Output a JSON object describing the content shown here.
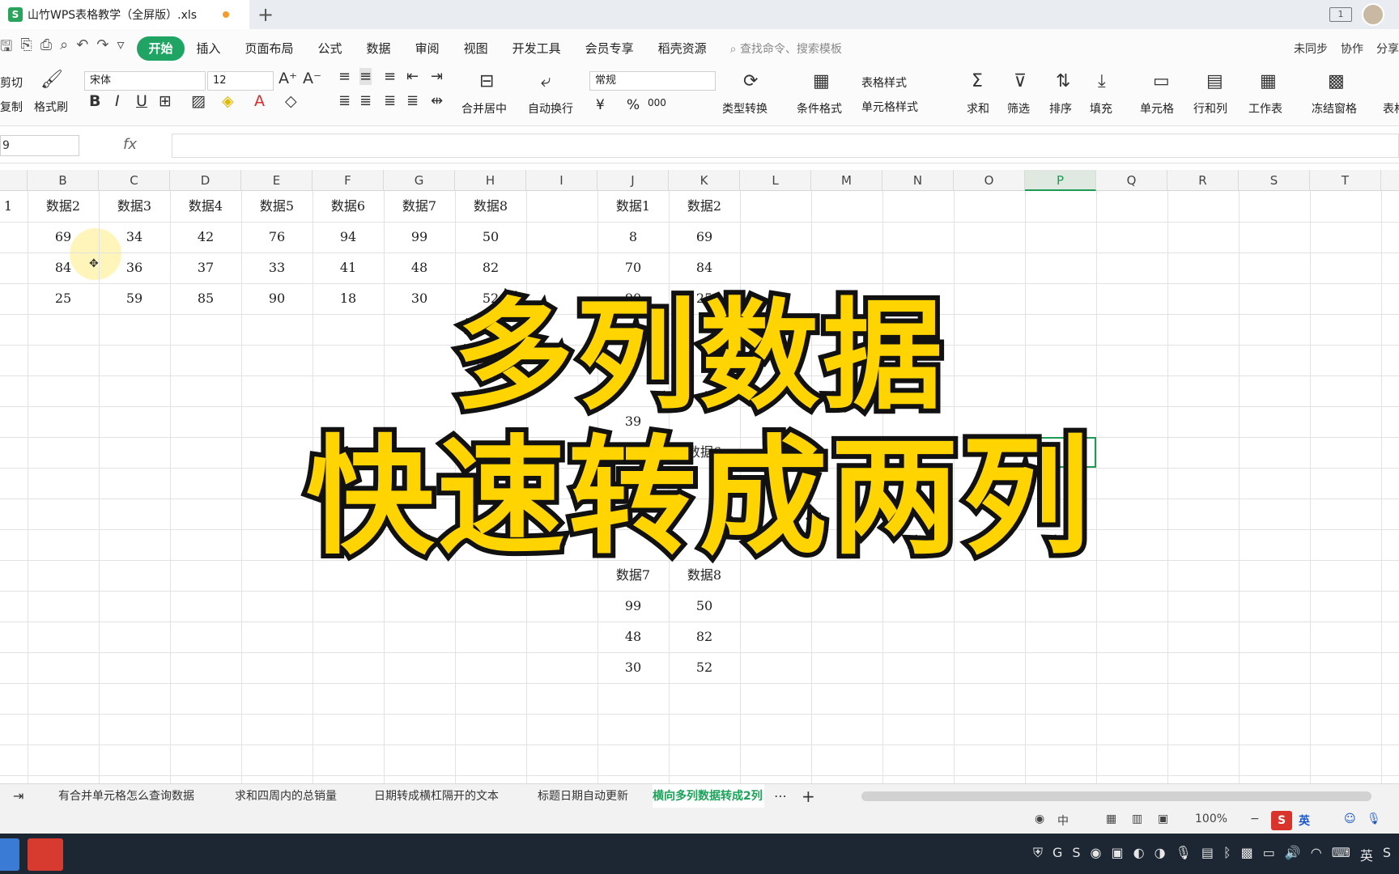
{
  "window": {
    "file_tab": "山竹WPS表格教学（全屏版）.xls",
    "new_tab_symbol": "+",
    "page_indicator": "1"
  },
  "menu": {
    "items": [
      "开始",
      "插入",
      "页面布局",
      "公式",
      "数据",
      "审阅",
      "视图",
      "开发工具",
      "会员专享",
      "稻壳资源"
    ],
    "active_index": 0,
    "search_placeholder": "查找命令、搜索模板",
    "right": [
      "未同步",
      "协作",
      "分享"
    ]
  },
  "ribbon": {
    "cut": "剪切",
    "copy": "复制",
    "format_painter": "格式刷",
    "font_name": "宋体",
    "font_size": "12",
    "bold": "B",
    "italic": "I",
    "underline": "U",
    "number_format": "常规",
    "merge_center": "合并居中",
    "wrap_text": "自动换行",
    "type_convert": "类型转换",
    "conditional_format": "条件格式",
    "table_style": "表格样式",
    "cell_style": "单元格样式",
    "sum": "求和",
    "filter": "筛选",
    "sort": "排序",
    "fill": "填充",
    "cell": "单元格",
    "rows_cols": "行和列",
    "worksheet": "工作表",
    "freeze": "冻结窗格",
    "table_tool": "表格",
    "currency": "¥",
    "percent": "%",
    "thousands": "000"
  },
  "formula_bar": {
    "name_box": "9",
    "fx_label": "fx",
    "value": ""
  },
  "columns": [
    "B",
    "C",
    "D",
    "E",
    "F",
    "G",
    "H",
    "I",
    "J",
    "K",
    "L",
    "M",
    "N",
    "O",
    "P",
    "Q",
    "R",
    "S",
    "T"
  ],
  "selected_column": "P",
  "left_table": {
    "partial_header": "1",
    "headers": [
      "数据2",
      "数据3",
      "数据4",
      "数据5",
      "数据6",
      "数据7",
      "数据8"
    ],
    "rows": [
      [
        "69",
        "34",
        "42",
        "76",
        "94",
        "99",
        "50"
      ],
      [
        "84",
        "36",
        "37",
        "33",
        "41",
        "48",
        "82"
      ],
      [
        "25",
        "59",
        "85",
        "90",
        "18",
        "30",
        "52"
      ]
    ]
  },
  "right_table": {
    "headers": [
      "数据1",
      "数据2"
    ],
    "rows": [
      [
        "8",
        "69"
      ],
      [
        "70",
        "84"
      ],
      [
        "90",
        "25"
      ]
    ],
    "partial_visible": [
      "39",
      "数据6",
      "数据7",
      "数据8"
    ],
    "bottom_rows": [
      [
        "99",
        "50"
      ],
      [
        "48",
        "82"
      ],
      [
        "30",
        "52"
      ]
    ]
  },
  "overlay": {
    "line1": "多列数据",
    "line2": "快速转成两列"
  },
  "sheet_tabs": [
    "有合并单元格怎么查询数据",
    "求和四周内的总销量",
    "日期转成横杠隔开的文本",
    "标题日期自动更新",
    "横向多列数据转成2列"
  ],
  "active_sheet_index": 4,
  "status": {
    "zoom": "100%",
    "ime_label": "英"
  },
  "colors": {
    "accent": "#1fa463",
    "caption_fill": "#ffd400",
    "caption_stroke": "#111111"
  }
}
